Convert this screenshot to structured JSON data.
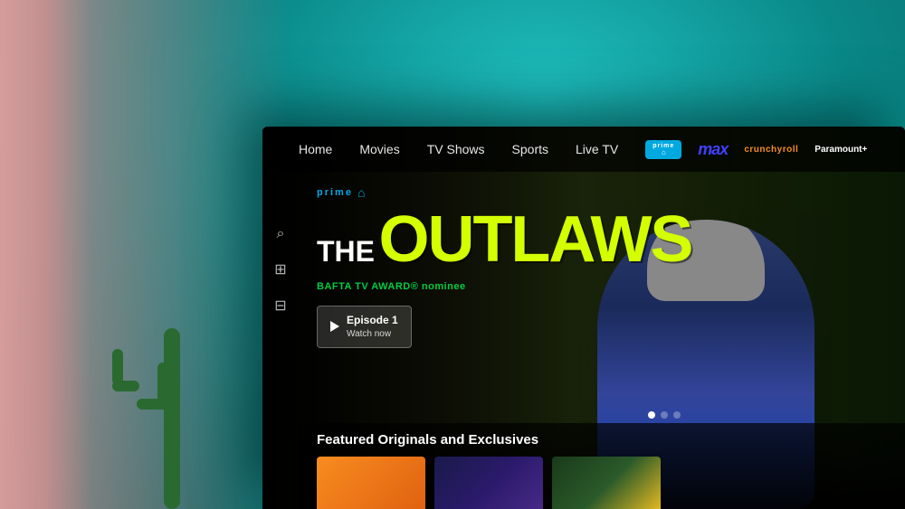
{
  "room": {
    "description": "Living room with teal wall and TV"
  },
  "nav": {
    "items": [
      {
        "label": "Home",
        "active": false
      },
      {
        "label": "Movies",
        "active": false
      },
      {
        "label": "TV Shows",
        "active": false
      },
      {
        "label": "Sports",
        "active": false
      },
      {
        "label": "Live TV",
        "active": false
      }
    ],
    "channels": {
      "prime": {
        "text": "prime",
        "arrow": "⌂"
      },
      "max": "max",
      "crunchyroll": "crunchyroll",
      "paramount": "Paramount+"
    }
  },
  "hero": {
    "badge_label": "prime",
    "title_the": "THE",
    "title_main": "OUTLAWS",
    "award_text": "BAFTA TV AWARD® nominee",
    "button_episode": "Episode 1",
    "button_action": "Watch now"
  },
  "sidebar": {
    "icons": [
      {
        "name": "search",
        "symbol": "⌕"
      },
      {
        "name": "grid",
        "symbol": "⊞"
      },
      {
        "name": "bookmark",
        "symbol": "⊟"
      }
    ]
  },
  "bottom": {
    "section_title": "Featured Originals and Exclusives",
    "thumbnails": [
      {
        "color": "orange",
        "label": "thumb1"
      },
      {
        "color": "purple",
        "label": "thumb2"
      },
      {
        "color": "mixed",
        "label": "thumb3"
      }
    ]
  },
  "pagination": {
    "dots": [
      {
        "active": true
      },
      {
        "active": false
      },
      {
        "active": false
      }
    ]
  }
}
